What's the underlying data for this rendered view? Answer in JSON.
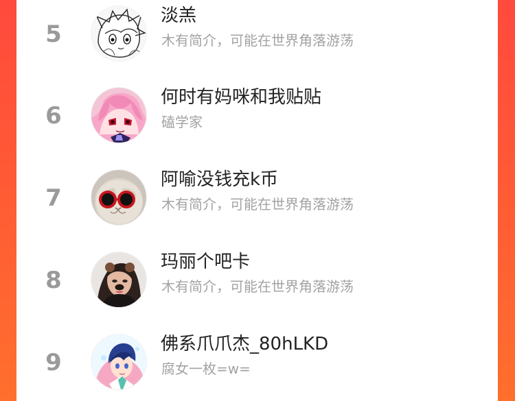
{
  "colors": {
    "background": "#ff5a35",
    "panel": "#ffffff",
    "rank": "#9a9a9a",
    "name": "#222222",
    "bio": "#a3a3a3"
  },
  "rank_list": {
    "items": [
      {
        "rank": "5",
        "name": "淡羔",
        "bio": "木有简介，可能在世界角落游荡"
      },
      {
        "rank": "6",
        "name": "何时有妈咪和我贴贴",
        "bio": "磕学家"
      },
      {
        "rank": "7",
        "name": "阿喻没钱充k币",
        "bio": "木有简介，可能在世界角落游荡"
      },
      {
        "rank": "8",
        "name": "玛丽个吧卡",
        "bio": "木有简介，可能在世界角落游荡"
      },
      {
        "rank": "9",
        "name": "佛系爪爪杰_80hLKD",
        "bio": "腐女一枚=w="
      }
    ]
  }
}
